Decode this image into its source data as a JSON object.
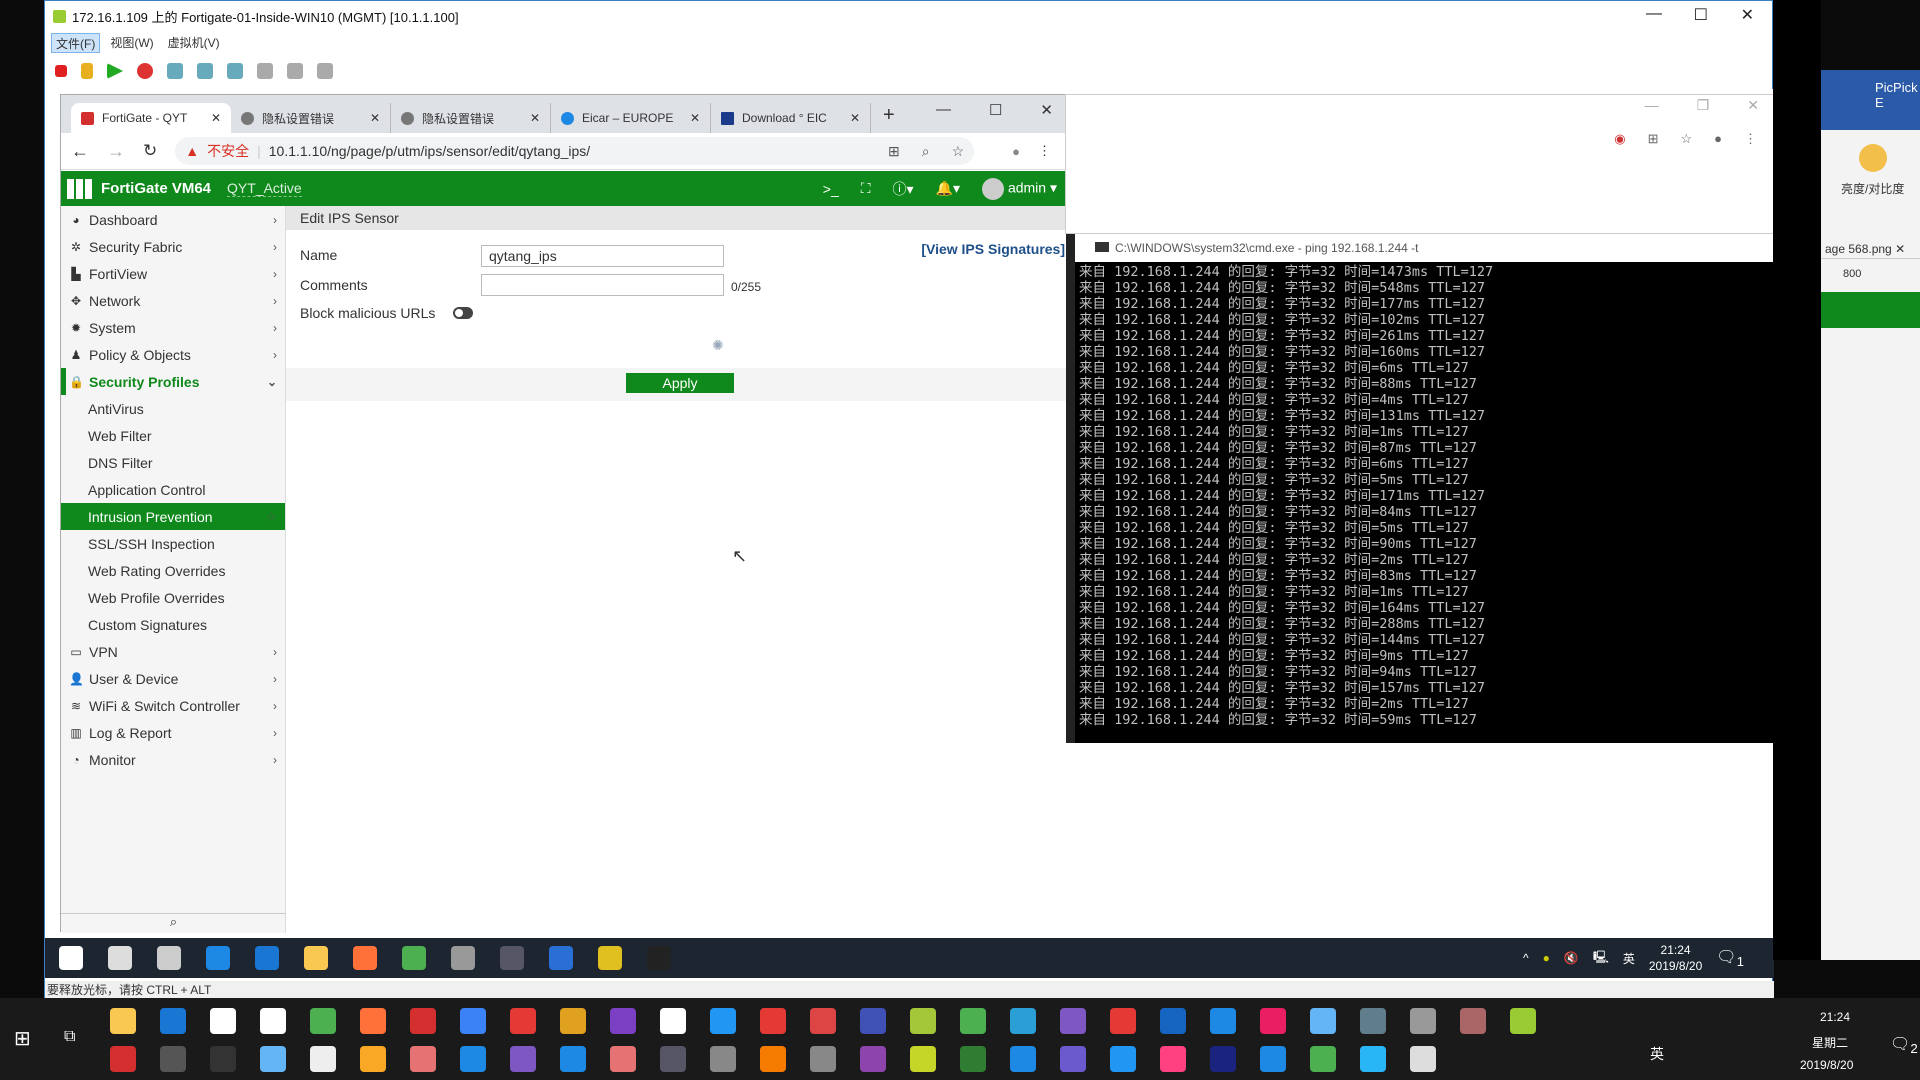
{
  "vm": {
    "title": "172.16.1.109 上的 Fortigate-01-Inside-WIN10 (MGMT) [10.1.1.100]",
    "menu": [
      "文件(F)",
      "视图(W)",
      "虚拟机(V)"
    ],
    "status": "要释放光标，请按 CTRL + ALT"
  },
  "browser": {
    "tabs": [
      "FortiGate - QYT",
      "隐私设置错误",
      "隐私设置错误",
      "Eicar – EUROPE",
      "Download ° EIC"
    ],
    "insecure": "不安全",
    "url": "10.1.1.10/ng/page/p/utm/ips/sensor/edit/qytang_ips/"
  },
  "header": {
    "brand": "FortiGate VM64",
    "host": "QYT_Active",
    "user": "admin"
  },
  "sidebar": {
    "items": [
      {
        "label": "Dashboard",
        "icon": "dashboard-icon",
        "glyph": "◕"
      },
      {
        "label": "Security Fabric",
        "icon": "fabric-icon",
        "glyph": "✲"
      },
      {
        "label": "FortiView",
        "icon": "chart-icon",
        "glyph": "▙"
      },
      {
        "label": "Network",
        "icon": "network-icon",
        "glyph": "✥"
      },
      {
        "label": "System",
        "icon": "gear-icon",
        "glyph": "✹"
      },
      {
        "label": "Policy & Objects",
        "icon": "policy-icon",
        "glyph": "♟"
      },
      {
        "label": "Security Profiles",
        "icon": "lock-icon",
        "glyph": "🔒"
      }
    ],
    "sub": [
      "AntiVirus",
      "Web Filter",
      "DNS Filter",
      "Application Control",
      "Intrusion Prevention",
      "SSL/SSH Inspection",
      "Web Rating Overrides",
      "Web Profile Overrides",
      "Custom Signatures"
    ],
    "after": [
      {
        "label": "VPN",
        "icon": "vpn-icon",
        "glyph": "▭"
      },
      {
        "label": "User & Device",
        "icon": "user-icon",
        "glyph": "👤"
      },
      {
        "label": "WiFi & Switch Controller",
        "icon": "wifi-icon",
        "glyph": "≋"
      },
      {
        "label": "Log & Report",
        "icon": "log-icon",
        "glyph": "▥"
      },
      {
        "label": "Monitor",
        "icon": "monitor-icon",
        "glyph": "◔"
      }
    ]
  },
  "form": {
    "title": "Edit IPS Sensor",
    "name_label": "Name",
    "name_value": "qytang_ips",
    "comments_label": "Comments",
    "comments_value": "",
    "count": "0/255",
    "block_label": "Block malicious URLs",
    "block_enabled": false,
    "view_sigs": "[View IPS Signatures]",
    "apply": "Apply"
  },
  "cmd": {
    "title": "C:\\WINDOWS\\system32\\cmd.exe - ping  192.168.1.244 -t",
    "lines": [
      "来自 192.168.1.244 的回复: 字节=32 时间=1473ms TTL=127",
      "来自 192.168.1.244 的回复: 字节=32 时间=548ms TTL=127",
      "来自 192.168.1.244 的回复: 字节=32 时间=177ms TTL=127",
      "来自 192.168.1.244 的回复: 字节=32 时间=102ms TTL=127",
      "来自 192.168.1.244 的回复: 字节=32 时间=261ms TTL=127",
      "来自 192.168.1.244 的回复: 字节=32 时间=160ms TTL=127",
      "来自 192.168.1.244 的回复: 字节=32 时间=6ms TTL=127",
      "来自 192.168.1.244 的回复: 字节=32 时间=88ms TTL=127",
      "来自 192.168.1.244 的回复: 字节=32 时间=4ms TTL=127",
      "来自 192.168.1.244 的回复: 字节=32 时间=131ms TTL=127",
      "来自 192.168.1.244 的回复: 字节=32 时间=1ms TTL=127",
      "来自 192.168.1.244 的回复: 字节=32 时间=87ms TTL=127",
      "来自 192.168.1.244 的回复: 字节=32 时间=6ms TTL=127",
      "来自 192.168.1.244 的回复: 字节=32 时间=5ms TTL=127",
      "来自 192.168.1.244 的回复: 字节=32 时间=171ms TTL=127",
      "来自 192.168.1.244 的回复: 字节=32 时间=84ms TTL=127",
      "来自 192.168.1.244 的回复: 字节=32 时间=5ms TTL=127",
      "来自 192.168.1.244 的回复: 字节=32 时间=90ms TTL=127",
      "来自 192.168.1.244 的回复: 字节=32 时间=2ms TTL=127",
      "来自 192.168.1.244 的回复: 字节=32 时间=83ms TTL=127",
      "来自 192.168.1.244 的回复: 字节=32 时间=1ms TTL=127",
      "来自 192.168.1.244 的回复: 字节=32 时间=164ms TTL=127",
      "来自 192.168.1.244 的回复: 字节=32 时间=288ms TTL=127",
      "来自 192.168.1.244 的回复: 字节=32 时间=144ms TTL=127",
      "来自 192.168.1.244 的回复: 字节=32 时间=9ms TTL=127",
      "来自 192.168.1.244 的回复: 字节=32 时间=94ms TTL=127",
      "来自 192.168.1.244 的回复: 字节=32 时间=157ms TTL=127",
      "来自 192.168.1.244 的回复: 字节=32 时间=2ms TTL=127",
      "来自 192.168.1.244 的回复: 字节=32 时间=59ms TTL=127"
    ]
  },
  "picpick": {
    "title": "PicPick E",
    "brightness": "亮度/对比度",
    "tab": "age 568.png",
    "ruler": "800"
  },
  "guest_taskbar": {
    "time": "21:24",
    "date": "2019/8/20",
    "ime": "英",
    "notif": "1",
    "icons": [
      "#fff",
      "#ddd",
      "#ccc",
      "#1e88e5",
      "#1976d2",
      "#f9c851",
      "#ff7139",
      "#4caf50",
      "#999",
      "#556",
      "#2a6fd6",
      "#e0c020",
      "#222"
    ]
  },
  "host_taskbar": {
    "time": "21:24",
    "weekday": "星期二",
    "date": "2019/8/20",
    "ime": "英",
    "notif": "2",
    "row1": [
      "#f9c851",
      "#1976d2",
      "#fff",
      "#fff",
      "#4caf50",
      "#ff7139",
      "#d32f2f",
      "#3b82f6",
      "#e53935",
      "#e0a020",
      "#7b3fc4",
      "#fff",
      "#2196f3",
      "#e53935",
      "#d44",
      "#3f51b5",
      "#a4c639",
      "#4caf50",
      "#2a9fd6",
      "#7e57c2",
      "#e53935",
      "#1565c0",
      "#1e88e5",
      "#e91e63",
      "#64b5f6",
      "#607d8b",
      "#999",
      "#a66",
      "#9c3"
    ],
    "row2": [
      "#d32f2f",
      "#555",
      "#333",
      "#64b5f6",
      "#eee",
      "#f9a825",
      "#e57373",
      "#1e88e5",
      "#7e57c2",
      "#1e88e5",
      "#e57373",
      "#556",
      "#888",
      "#f57c00",
      "#888",
      "#8e44ad",
      "#c6d629",
      "#2e7d32",
      "#1e88e5",
      "#6a5acd",
      "#2196f3",
      "#ff4081",
      "#1a237e",
      "#1e88e5",
      "#4caf50",
      "#29b6f6",
      "#ddd"
    ]
  }
}
